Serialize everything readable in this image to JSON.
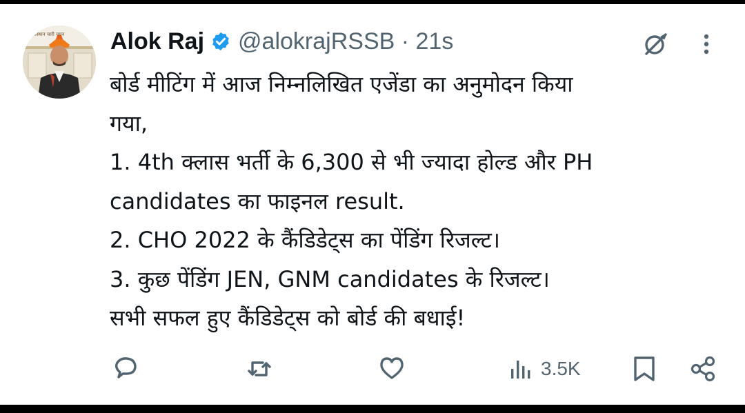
{
  "author": {
    "name": "Alok Raj",
    "handle_line": "@alokrajRSSB · 21s",
    "avatar_banner_text": "राजस्थान   चारी चयन"
  },
  "tweet": {
    "lines": [
      "बोर्ड मीटिंग में आज निम्नलिखित एजेंडा का अनुमोदन किया",
      "गया,",
      "1. 4th क्लास भर्ती के 6,300 से भी ज्यादा होल्ड और PH",
      "candidates का फाइनल result.",
      "2. CHO 2022 के कैंडिडेट्स का पेंडिंग रिजल्ट।",
      "3. कुछ पेंडिंग JEN, GNM  candidates के रिजल्ट।",
      "सभी सफल हुए कैंडिडेट्स को बोर्ड की बधाई!"
    ]
  },
  "actions": {
    "views": "3.5K"
  },
  "icons": [
    "verified-badge-icon",
    "grok-icon",
    "more-options-icon",
    "reply-icon",
    "retweet-icon",
    "like-icon",
    "views-icon",
    "bookmark-icon",
    "share-icon"
  ],
  "colors": {
    "verified": "#1d9bf0",
    "text": "#0f1419",
    "secondary": "#536471"
  }
}
